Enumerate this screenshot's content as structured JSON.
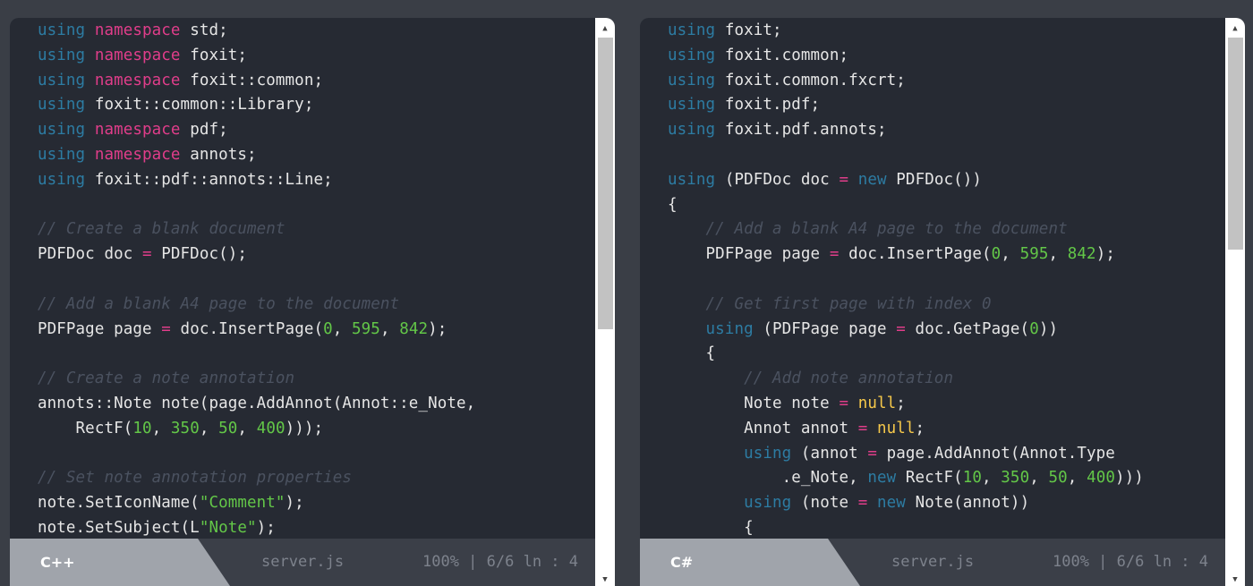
{
  "left": {
    "lang": "C++",
    "file": "server.js",
    "position": "100% | 6/6 ln : 4",
    "scroll_thumb_fraction": 0.55,
    "lines": [
      [
        [
          "kw",
          "using "
        ],
        [
          "ns",
          "namespace "
        ],
        [
          "tok",
          "std;"
        ]
      ],
      [
        [
          "kw",
          "using "
        ],
        [
          "ns",
          "namespace "
        ],
        [
          "tok",
          "foxit;"
        ]
      ],
      [
        [
          "kw",
          "using "
        ],
        [
          "ns",
          "namespace "
        ],
        [
          "tok",
          "foxit::common;"
        ]
      ],
      [
        [
          "kw",
          "using "
        ],
        [
          "tok",
          "foxit::common::Library;"
        ]
      ],
      [
        [
          "kw",
          "using "
        ],
        [
          "ns",
          "namespace "
        ],
        [
          "tok",
          "pdf;"
        ]
      ],
      [
        [
          "kw",
          "using "
        ],
        [
          "ns",
          "namespace "
        ],
        [
          "tok",
          "annots;"
        ]
      ],
      [
        [
          "kw",
          "using "
        ],
        [
          "tok",
          "foxit::pdf::annots::Line;"
        ]
      ],
      [],
      [
        [
          "cm",
          "// Create a blank document"
        ]
      ],
      [
        [
          "tok",
          "PDFDoc doc "
        ],
        [
          "op",
          "="
        ],
        [
          "tok",
          " PDFDoc();"
        ]
      ],
      [],
      [
        [
          "cm",
          "// Add a blank A4 page to the document"
        ]
      ],
      [
        [
          "tok",
          "PDFPage page "
        ],
        [
          "op",
          "="
        ],
        [
          "tok",
          " doc.InsertPage("
        ],
        [
          "num",
          "0"
        ],
        [
          "tok",
          ", "
        ],
        [
          "num",
          "595"
        ],
        [
          "tok",
          ", "
        ],
        [
          "num",
          "842"
        ],
        [
          "tok",
          ");"
        ]
      ],
      [],
      [
        [
          "cm",
          "// Create a note annotation"
        ]
      ],
      [
        [
          "tok",
          "annots::Note note(page.AddAnnot(Annot::e_Note,"
        ]
      ],
      [
        [
          "tok",
          "    RectF("
        ],
        [
          "num",
          "10"
        ],
        [
          "tok",
          ", "
        ],
        [
          "num",
          "350"
        ],
        [
          "tok",
          ", "
        ],
        [
          "num",
          "50"
        ],
        [
          "tok",
          ", "
        ],
        [
          "num",
          "400"
        ],
        [
          "tok",
          ")));"
        ]
      ],
      [],
      [
        [
          "cm",
          "// Set note annotation properties"
        ]
      ],
      [
        [
          "tok",
          "note.SetIconName("
        ],
        [
          "str",
          "\"Comment\""
        ],
        [
          "tok",
          ");"
        ]
      ],
      [
        [
          "tok",
          "note.SetSubject(L"
        ],
        [
          "str",
          "\"Note\""
        ],
        [
          "tok",
          ");"
        ]
      ]
    ]
  },
  "right": {
    "lang": "C#",
    "file": "server.js",
    "position": "100% | 6/6 ln : 4",
    "scroll_thumb_fraction": 0.4,
    "lines": [
      [
        [
          "kw",
          "using "
        ],
        [
          "tok",
          "foxit;"
        ]
      ],
      [
        [
          "kw",
          "using "
        ],
        [
          "tok",
          "foxit.common;"
        ]
      ],
      [
        [
          "kw",
          "using "
        ],
        [
          "tok",
          "foxit.common.fxcrt;"
        ]
      ],
      [
        [
          "kw",
          "using "
        ],
        [
          "tok",
          "foxit.pdf;"
        ]
      ],
      [
        [
          "kw",
          "using "
        ],
        [
          "tok",
          "foxit.pdf.annots;"
        ]
      ],
      [],
      [
        [
          "kw",
          "using "
        ],
        [
          "tok",
          "(PDFDoc doc "
        ],
        [
          "op",
          "="
        ],
        [
          "kw",
          " new "
        ],
        [
          "tok",
          "PDFDoc())"
        ]
      ],
      [
        [
          "tok",
          "{"
        ]
      ],
      [
        [
          "tok",
          "    "
        ],
        [
          "cm",
          "// Add a blank A4 page to the document"
        ]
      ],
      [
        [
          "tok",
          "    PDFPage page "
        ],
        [
          "op",
          "="
        ],
        [
          "tok",
          " doc.InsertPage("
        ],
        [
          "num",
          "0"
        ],
        [
          "tok",
          ", "
        ],
        [
          "num",
          "595"
        ],
        [
          "tok",
          ", "
        ],
        [
          "num",
          "842"
        ],
        [
          "tok",
          ");"
        ]
      ],
      [],
      [
        [
          "tok",
          "    "
        ],
        [
          "cm",
          "// Get first page with index 0"
        ]
      ],
      [
        [
          "tok",
          "    "
        ],
        [
          "kw",
          "using "
        ],
        [
          "tok",
          "(PDFPage page "
        ],
        [
          "op",
          "="
        ],
        [
          "tok",
          " doc.GetPage("
        ],
        [
          "num",
          "0"
        ],
        [
          "tok",
          "))"
        ]
      ],
      [
        [
          "tok",
          "    {"
        ]
      ],
      [
        [
          "tok",
          "        "
        ],
        [
          "cm",
          "// Add note annotation"
        ]
      ],
      [
        [
          "tok",
          "        Note note "
        ],
        [
          "op",
          "="
        ],
        [
          "tok",
          " "
        ],
        [
          "nl",
          "null"
        ],
        [
          "tok",
          ";"
        ]
      ],
      [
        [
          "tok",
          "        Annot annot "
        ],
        [
          "op",
          "="
        ],
        [
          "tok",
          " "
        ],
        [
          "nl",
          "null"
        ],
        [
          "tok",
          ";"
        ]
      ],
      [
        [
          "tok",
          "        "
        ],
        [
          "kw",
          "using "
        ],
        [
          "tok",
          "(annot "
        ],
        [
          "op",
          "="
        ],
        [
          "tok",
          " page.AddAnnot(Annot.Type"
        ]
      ],
      [
        [
          "tok",
          "            .e_Note, "
        ],
        [
          "kw",
          "new "
        ],
        [
          "tok",
          "RectF("
        ],
        [
          "num",
          "10"
        ],
        [
          "tok",
          ", "
        ],
        [
          "num",
          "350"
        ],
        [
          "tok",
          ", "
        ],
        [
          "num",
          "50"
        ],
        [
          "tok",
          ", "
        ],
        [
          "num",
          "400"
        ],
        [
          "tok",
          ")))"
        ]
      ],
      [
        [
          "tok",
          "        "
        ],
        [
          "kw",
          "using "
        ],
        [
          "tok",
          "(note "
        ],
        [
          "op",
          "="
        ],
        [
          "kw",
          " new "
        ],
        [
          "tok",
          "Note(annot))"
        ]
      ],
      [
        [
          "tok",
          "        {"
        ]
      ]
    ]
  }
}
